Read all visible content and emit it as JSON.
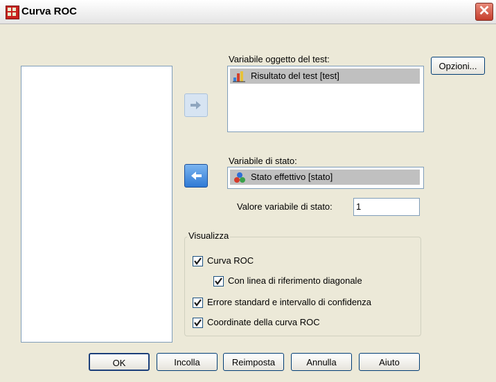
{
  "window": {
    "title": "Curva ROC",
    "close_label": "✕"
  },
  "buttons": {
    "options": "Opzioni...",
    "ok": "OK",
    "paste": "Incolla",
    "reset": "Reimposta",
    "cancel": "Annulla",
    "help": "Aiuto"
  },
  "test_variable": {
    "label": "Variabile oggetto del test:",
    "items": [
      "Risultato del test [test]"
    ]
  },
  "state_variable": {
    "label": "Variabile di stato:",
    "value": "Stato effettivo [stato]"
  },
  "state_value": {
    "label": "Valore variabile di stato:",
    "value": "1"
  },
  "display": {
    "title": "Visualizza",
    "roc_curve": {
      "label": "Curva ROC",
      "checked": true
    },
    "diagonal_reference": {
      "label": "Con linea di riferimento diagonale",
      "checked": true
    },
    "std_error": {
      "label": "Errore standard e intervallo di confidenza",
      "checked": true
    },
    "coordinates": {
      "label": "Coordinate della curva ROC",
      "checked": true
    }
  }
}
